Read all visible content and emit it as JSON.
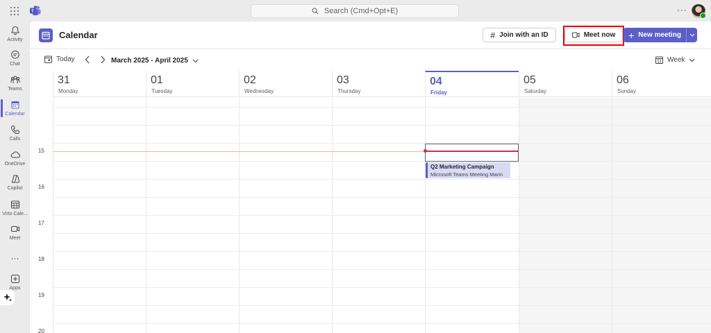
{
  "search": {
    "placeholder": "Search (Cmd+Opt+E)"
  },
  "rail": {
    "items": [
      {
        "label": "Activity",
        "icon": "bell-icon"
      },
      {
        "label": "Chat",
        "icon": "chat-icon"
      },
      {
        "label": "Teams",
        "icon": "teams-icon"
      },
      {
        "label": "Calendar",
        "icon": "calendar-icon"
      },
      {
        "label": "Calls",
        "icon": "phone-icon"
      },
      {
        "label": "OneDrive",
        "icon": "cloud-icon"
      },
      {
        "label": "Copilot",
        "icon": "copilot-icon"
      },
      {
        "label": "Virto Cale...",
        "icon": "grid-calendar-icon"
      },
      {
        "label": "Meet",
        "icon": "video-icon"
      },
      {
        "label": "Apps",
        "icon": "plus-square-icon"
      }
    ],
    "more": "···"
  },
  "header": {
    "title": "Calendar",
    "join_label": "Join with an ID",
    "meet_label": "Meet now",
    "new_label": "New meeting"
  },
  "toolbar": {
    "today_label": "Today",
    "range_label": "March 2025 - April 2025",
    "view_label": "Week"
  },
  "days": [
    {
      "num": "31",
      "name": "Monday"
    },
    {
      "num": "01",
      "name": "Tuesday"
    },
    {
      "num": "02",
      "name": "Wednesday"
    },
    {
      "num": "03",
      "name": "Thursday"
    },
    {
      "num": "04",
      "name": "Friday"
    },
    {
      "num": "05",
      "name": "Saturday"
    },
    {
      "num": "06",
      "name": "Sunday"
    }
  ],
  "hours": [
    "15",
    "16",
    "17",
    "18",
    "19",
    "20"
  ],
  "event": {
    "title": "Q2 Marketing Campaign",
    "subtitle": "Microsoft Teams Meeting  Marin"
  },
  "colors": {
    "accent": "#5b5fc7",
    "now_line": "#c4314b",
    "highlight": "#e00000"
  }
}
